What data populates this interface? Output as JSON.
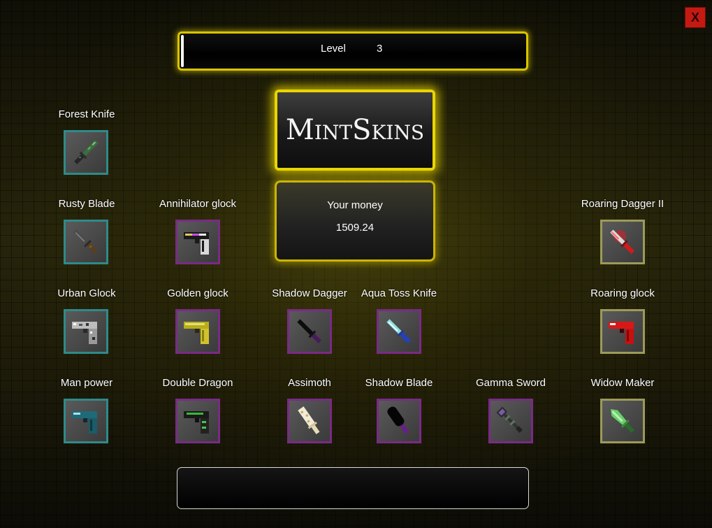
{
  "close_button": {
    "label": "X"
  },
  "level": {
    "label": "Level",
    "value": "3"
  },
  "logo": {
    "text": "MintSkins"
  },
  "money": {
    "label": "Your money",
    "value": "1509.24"
  },
  "items": [
    {
      "name": "Forest Knife",
      "rarity": "teal",
      "icon": "forest-knife-icon"
    },
    {
      "name": "Rusty Blade",
      "rarity": "teal",
      "icon": "rusty-blade-icon"
    },
    {
      "name": "Annihilator glock",
      "rarity": "purple",
      "icon": "annihilator-glock-icon"
    },
    {
      "name": "Roaring Dagger II",
      "rarity": "gold",
      "icon": "roaring-dagger-icon"
    },
    {
      "name": "Urban Glock",
      "rarity": "teal",
      "icon": "urban-glock-icon"
    },
    {
      "name": "Golden glock",
      "rarity": "purple",
      "icon": "golden-glock-icon"
    },
    {
      "name": "Shadow Dagger",
      "rarity": "purple",
      "icon": "shadow-dagger-icon"
    },
    {
      "name": "Aqua Toss Knife",
      "rarity": "purple",
      "icon": "aqua-toss-knife-icon"
    },
    {
      "name": "Roaring glock",
      "rarity": "gold",
      "icon": "roaring-glock-icon"
    },
    {
      "name": "Man power",
      "rarity": "teal",
      "icon": "man-power-icon"
    },
    {
      "name": "Double Dragon",
      "rarity": "purple",
      "icon": "double-dragon-icon"
    },
    {
      "name": "Assimoth",
      "rarity": "purple",
      "icon": "assimoth-icon"
    },
    {
      "name": "Shadow Blade",
      "rarity": "purple",
      "icon": "shadow-blade-icon"
    },
    {
      "name": "Gamma Sword",
      "rarity": "purple",
      "icon": "gamma-sword-icon"
    },
    {
      "name": "Widow Maker",
      "rarity": "gold",
      "icon": "widow-maker-icon"
    }
  ],
  "colors": {
    "accent_yellow": "#e9d500",
    "rarity_teal": "#2f8a8a",
    "rarity_purple": "#7a2a86",
    "rarity_gold": "#9c9a58",
    "close_red": "#c41a12"
  }
}
